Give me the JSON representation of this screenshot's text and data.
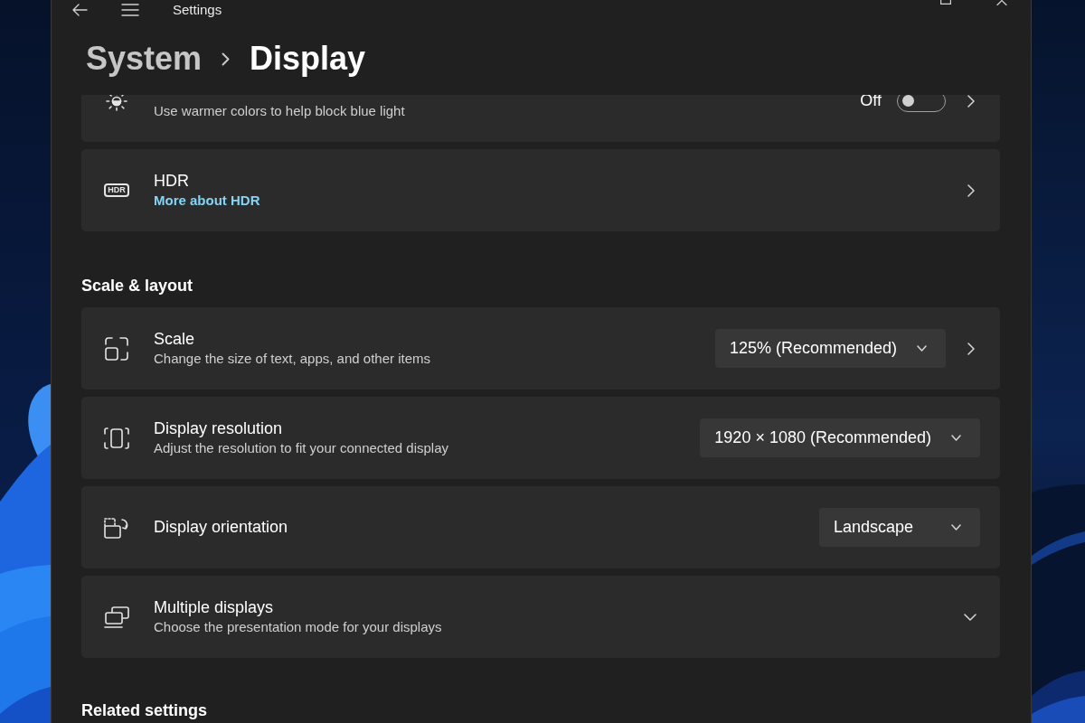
{
  "window": {
    "title": "Settings"
  },
  "breadcrumb": [
    {
      "label": "System",
      "current": false
    },
    {
      "label": "Display",
      "current": true
    }
  ],
  "sections": [
    {
      "items": [
        {
          "kind": "toggle",
          "subtitle": "Use warmer colors to help block blue light",
          "state_label": "Off",
          "on": false,
          "opens_page": true
        },
        {
          "kind": "link",
          "title": "HDR",
          "badge": "HDR",
          "link": "More about HDR",
          "opens_page": true
        }
      ]
    },
    {
      "heading": "Scale & layout",
      "items": [
        {
          "kind": "dropdown",
          "title": "Scale",
          "subtitle": "Change the size of text, apps, and other items",
          "value": "125% (Recommended)",
          "opens_page": true
        },
        {
          "kind": "dropdown",
          "title": "Display resolution",
          "subtitle": "Adjust the resolution to fit your connected display",
          "value": "1920 × 1080 (Recommended)",
          "opens_page": false
        },
        {
          "kind": "dropdown",
          "title": "Display orientation",
          "value": "Landscape",
          "opens_page": false
        },
        {
          "kind": "expander",
          "title": "Multiple displays",
          "subtitle": "Choose the presentation mode for your displays",
          "expanded": false
        }
      ]
    },
    {
      "heading": "Related settings"
    }
  ]
}
